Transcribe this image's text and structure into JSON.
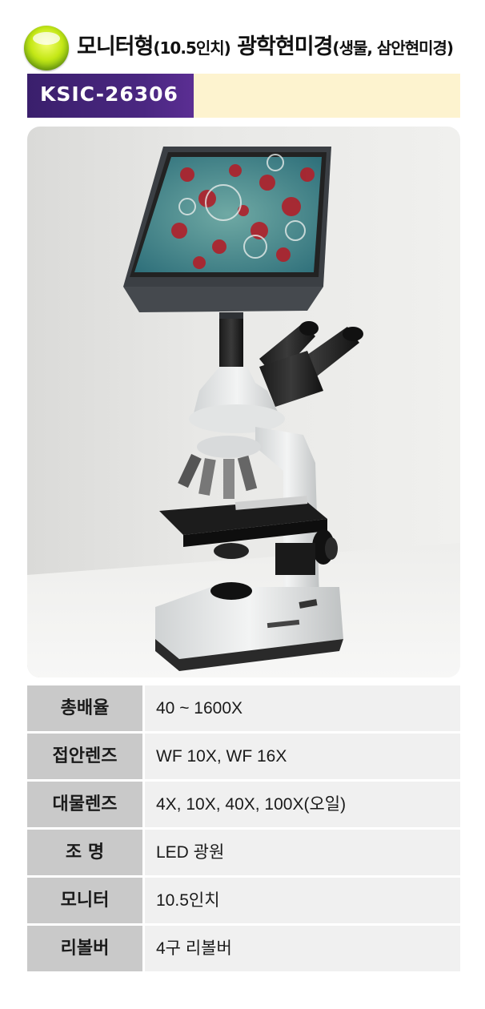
{
  "header": {
    "title_main": "모니터형",
    "title_sub1": "(10.5인치)",
    "title_main2": " 광학현미경",
    "title_sub2": "(생물, 삼안현미경)"
  },
  "product": {
    "code": "KSIC-26306"
  },
  "specs": [
    {
      "label": "총배율",
      "value": "40 ~ 1600X"
    },
    {
      "label": "접안렌즈",
      "value": "WF 10X, WF 16X"
    },
    {
      "label": "대물렌즈",
      "value": "4X, 10X, 40X, 100X(오일)"
    },
    {
      "label": "조 명",
      "value": "LED 광원"
    },
    {
      "label": "모니터",
      "value": "10.5인치"
    },
    {
      "label": "리볼버",
      "value": "4구 리볼버"
    }
  ],
  "colors": {
    "code_bar_bg": "#fdf3cf",
    "code_box": "#4a2781",
    "label_bg": "#c9c9c9",
    "value_bg": "#f0f0f0",
    "logo": "#c5e817"
  },
  "icons": {
    "logo": "green-orb-logo-icon"
  }
}
